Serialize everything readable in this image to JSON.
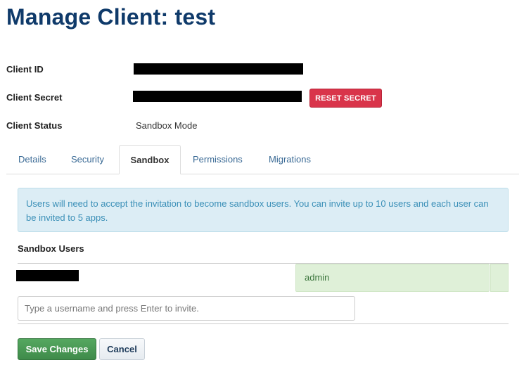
{
  "page": {
    "title": "Manage Client: test"
  },
  "client_info": {
    "client_id_label": "Client ID",
    "client_secret_label": "Client Secret",
    "client_status_label": "Client Status",
    "client_status_value": "Sandbox Mode",
    "reset_secret_label": "RESET SECRET"
  },
  "tabs": [
    {
      "label": "Details",
      "active": false
    },
    {
      "label": "Security",
      "active": false
    },
    {
      "label": "Sandbox",
      "active": true
    },
    {
      "label": "Permissions",
      "active": false
    },
    {
      "label": "Migrations",
      "active": false
    }
  ],
  "sandbox": {
    "info_message": "Users will need to accept the invitation to become sandbox users. You can invite up to 10 users and each user can be invited to 5 apps.",
    "section_title": "Sandbox Users",
    "users": [
      {
        "role": "admin"
      }
    ],
    "invite_placeholder": "Type a username and press Enter to invite."
  },
  "actions": {
    "save_label": "Save Changes",
    "cancel_label": "Cancel"
  },
  "colors": {
    "title": "#0f3a6a",
    "danger": "#d9344a",
    "success": "#3f8b4a",
    "info_bg": "#dcedf5",
    "tag_bg": "#dff0d8"
  }
}
